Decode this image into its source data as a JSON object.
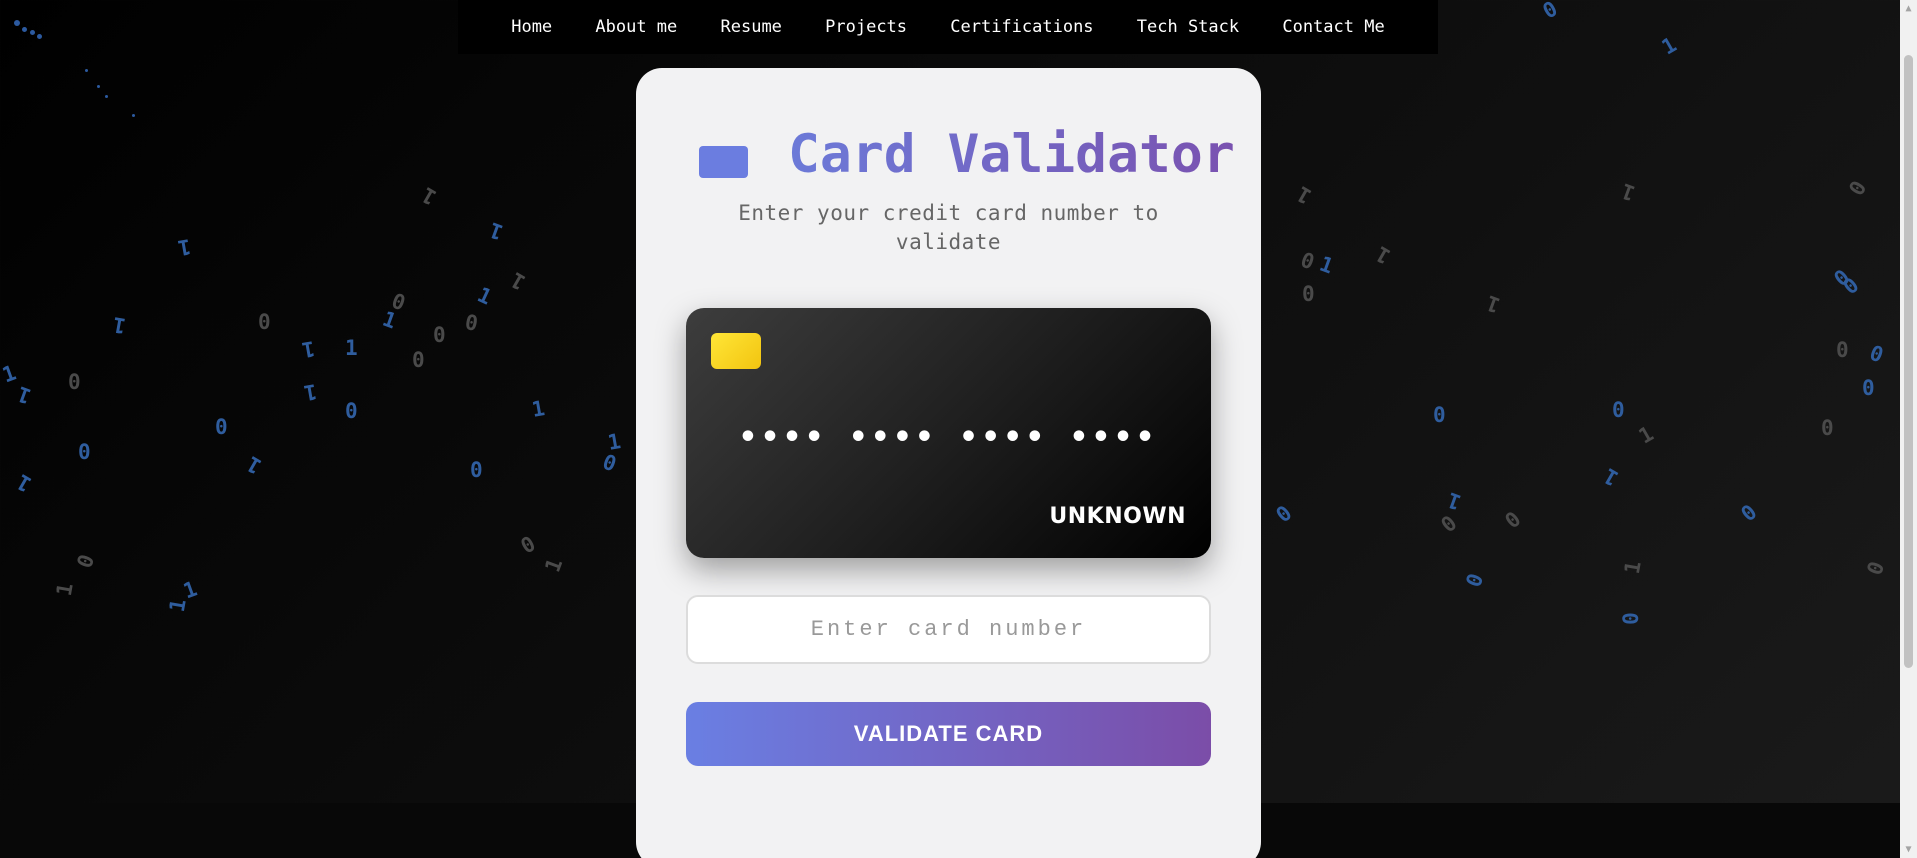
{
  "nav": {
    "items": [
      {
        "label": "Home"
      },
      {
        "label": "About me"
      },
      {
        "label": "Resume"
      },
      {
        "label": "Projects"
      },
      {
        "label": "Certifications"
      },
      {
        "label": "Tech Stack"
      },
      {
        "label": "Contact Me"
      }
    ]
  },
  "validator": {
    "title": "Card Validator",
    "subtitle": "Enter your credit card number to validate",
    "card_number_mask": "•••• •••• •••• ••••",
    "card_type": "UNKNOWN",
    "input_placeholder": "Enter card number",
    "button_label": "VALIDATE CARD"
  },
  "background": {
    "binary_digits": [
      "0",
      "1"
    ]
  },
  "colors": {
    "accent_start": "#6a7fe3",
    "accent_end": "#7b4da8",
    "chip": "#ffe637",
    "digit_blue": "#2f5d9e",
    "digit_gray": "#4a4a4a"
  }
}
